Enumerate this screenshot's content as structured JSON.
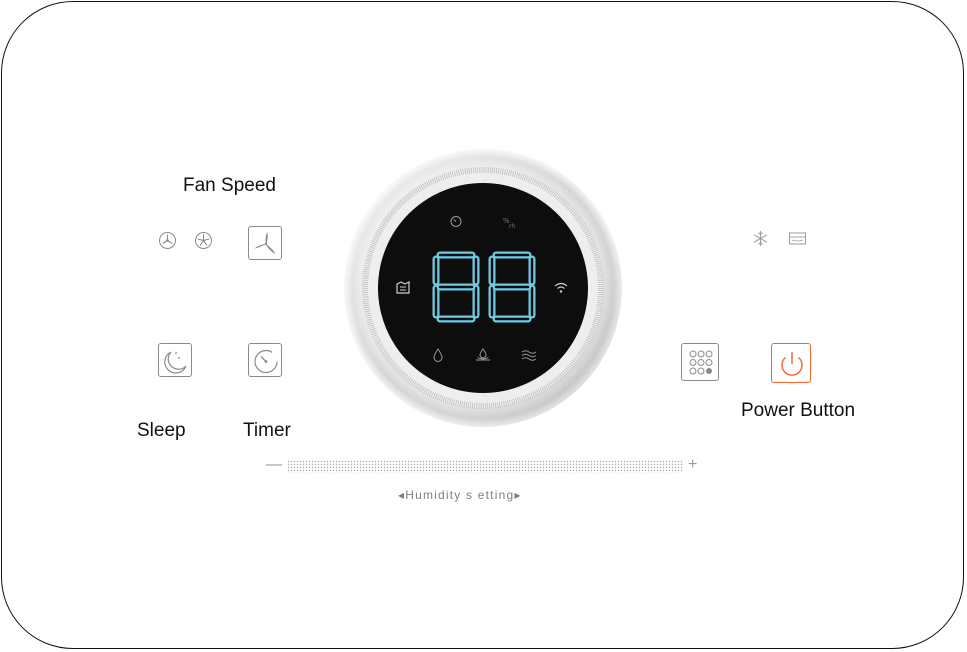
{
  "labels": {
    "fan_speed": "Fan Speed",
    "sleep": "Sleep",
    "timer": "Timer",
    "power_button": "Power Button"
  },
  "display": {
    "digits": "88"
  },
  "humidity": {
    "label": "◂Humidity s etting▸",
    "minus": "—",
    "plus": "+"
  },
  "colors": {
    "display_digits": "#6fcbe6",
    "power_accent": "#f0642b",
    "icon_gray": "#8a8a8a"
  },
  "icons": {
    "fan_low": "fan-low-icon",
    "fan_high": "fan-high-icon",
    "fan_speed": "fan-propeller-icon",
    "sleep": "moon-icon",
    "timer": "timer-icon",
    "defrost": "snowflake-icon",
    "tank": "water-tank-icon",
    "mode": "dot-grid-icon",
    "power": "power-icon",
    "display_timer": "clock-icon",
    "display_percent": "percent-icon",
    "display_laundry": "laundry-icon",
    "display_wifi": "wifi-icon",
    "display_drop": "water-drop-icon",
    "display_drain": "drain-icon",
    "display_wave": "wave-icon"
  }
}
